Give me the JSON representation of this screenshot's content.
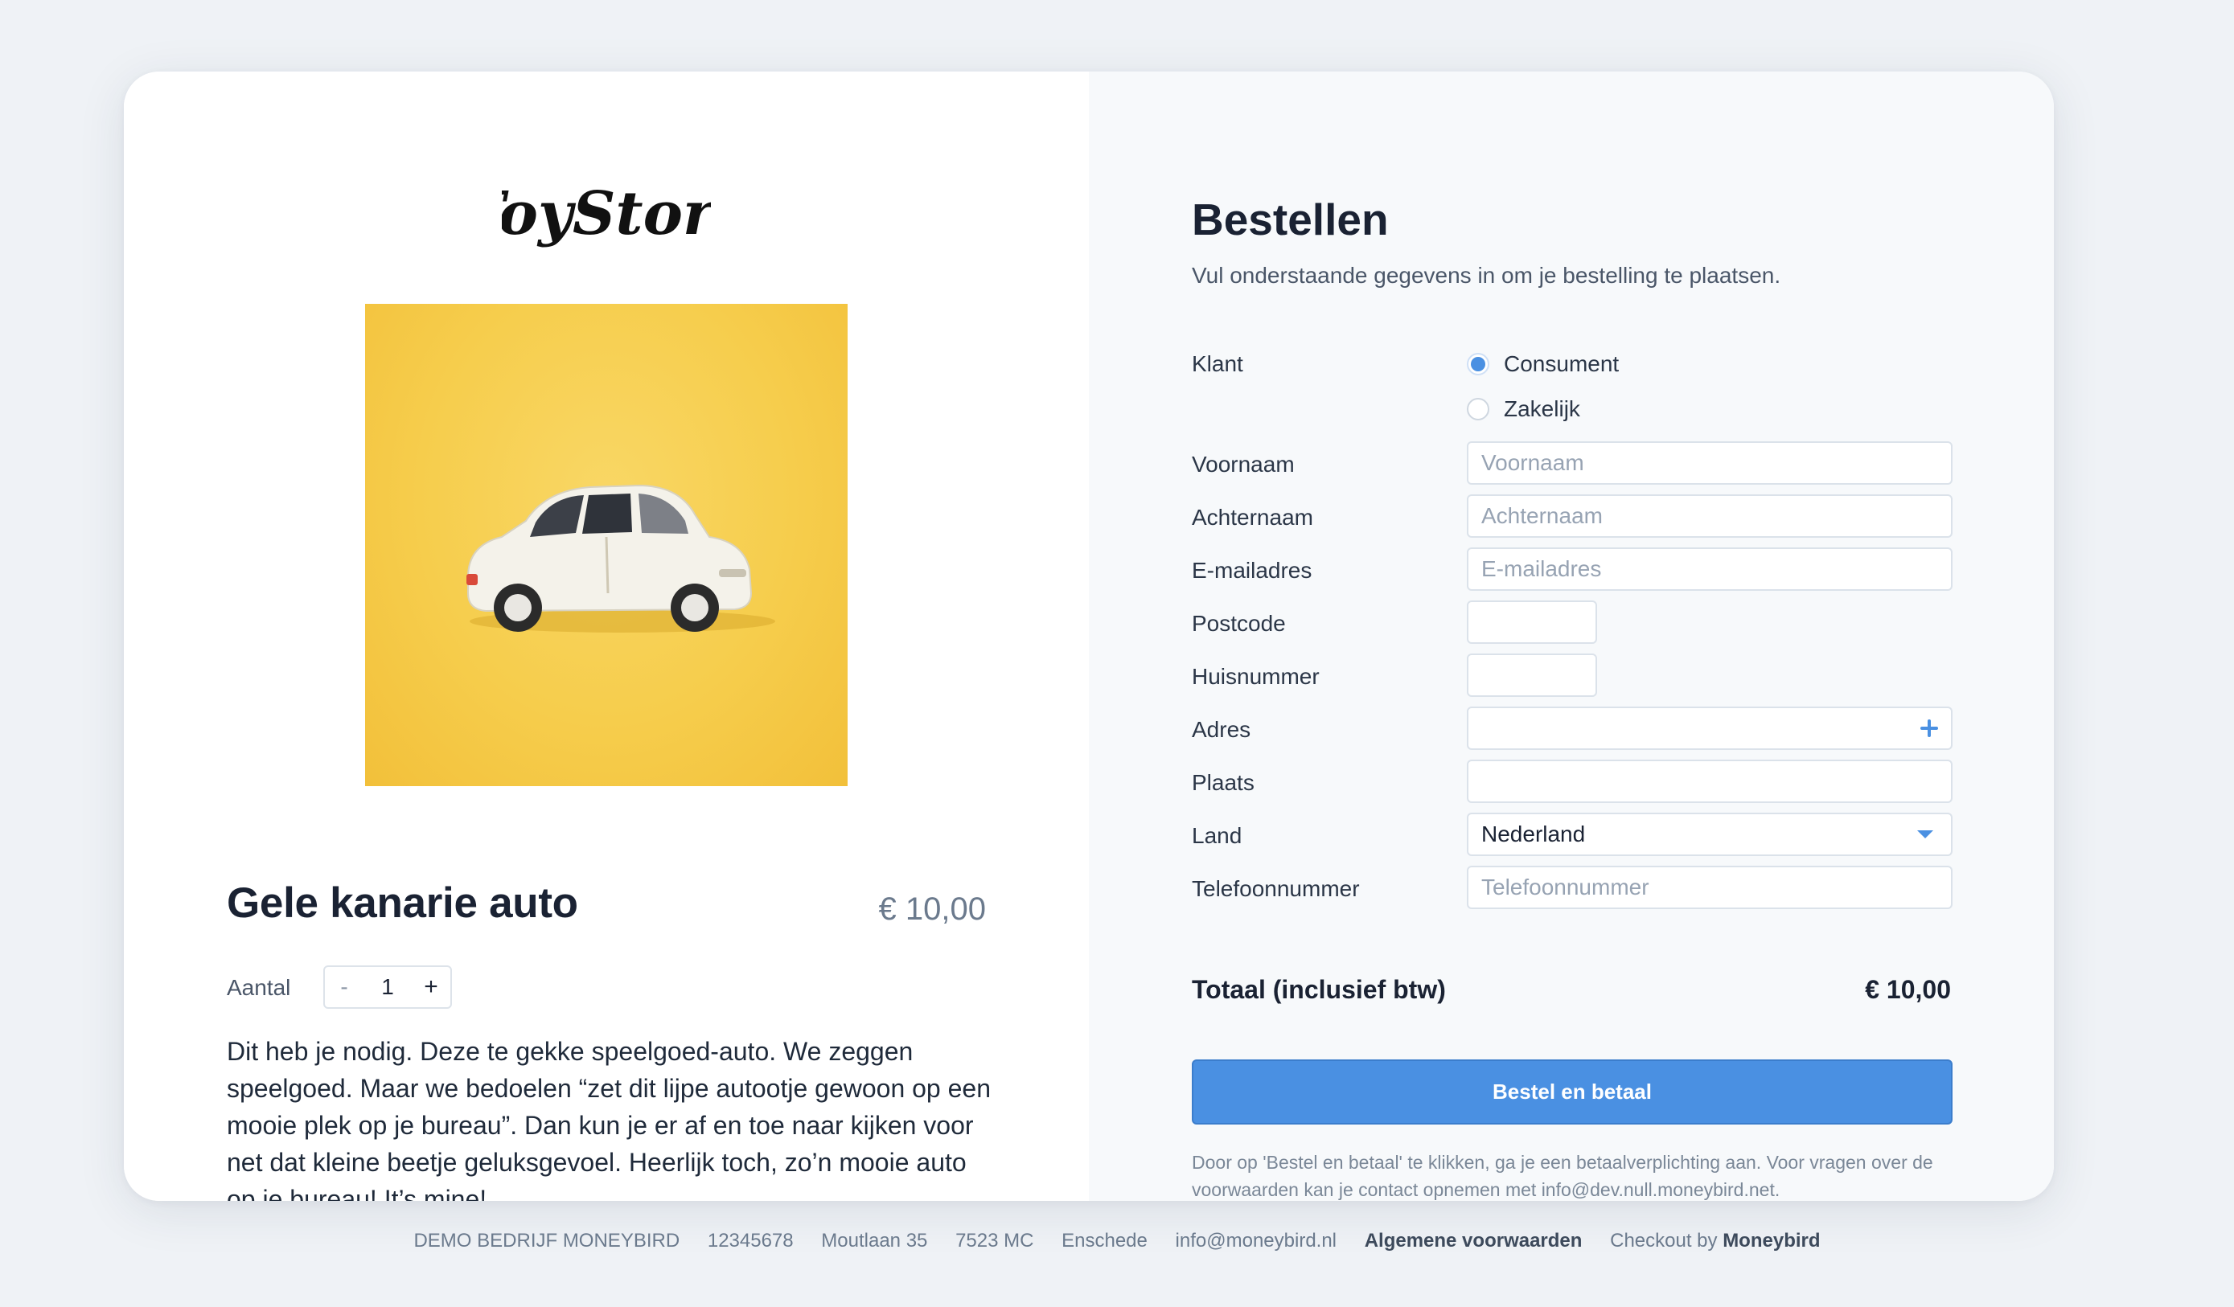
{
  "store": {
    "logo_text": "ToyStore"
  },
  "product": {
    "title": "Gele kanarie auto",
    "price": "€ 10,00",
    "quantity_label": "Aantal",
    "quantity_minus": "-",
    "quantity_value": "1",
    "quantity_plus": "+",
    "description": "Dit heb je nodig. Deze te gekke speelgoed-auto. We zeggen speelgoed. Maar we bedoelen “zet dit lijpe autootje gewoon op een mooie plek op je bureau”. Dan kun je er af en toe naar kijken voor net dat kleine beetje geluksgevoel. Heerlijk toch, zo’n mooie auto op je bureau! It’s mine!",
    "image_icon": "toy-car-photo",
    "image_background": "#f6cd4c"
  },
  "form": {
    "title": "Bestellen",
    "subtitle": "Vul onderstaande gegevens in om je bestelling te plaatsen.",
    "customer_label": "Klant",
    "customer_options": [
      {
        "label": "Consument",
        "checked": true
      },
      {
        "label": "Zakelijk",
        "checked": false
      }
    ],
    "fields": {
      "first_name": {
        "label": "Voornaam",
        "placeholder": "Voornaam",
        "value": ""
      },
      "last_name": {
        "label": "Achternaam",
        "placeholder": "Achternaam",
        "value": ""
      },
      "email": {
        "label": "E-mailadres",
        "placeholder": "E-mailadres",
        "value": ""
      },
      "postcode": {
        "label": "Postcode",
        "placeholder": "",
        "value": ""
      },
      "house_number": {
        "label": "Huisnummer",
        "placeholder": "",
        "value": ""
      },
      "address": {
        "label": "Adres",
        "placeholder": "",
        "value": ""
      },
      "city": {
        "label": "Plaats",
        "placeholder": "",
        "value": ""
      },
      "country": {
        "label": "Land",
        "value": "Nederland"
      },
      "phone": {
        "label": "Telefoonnummer",
        "placeholder": "Telefoonnummer",
        "value": ""
      }
    },
    "total_label": "Totaal (inclusief btw)",
    "total_value": "€ 10,00",
    "submit_label": "Bestel en betaal",
    "disclaimer": "Door op 'Bestel en betaal' te klikken, ga je een betaalverplichting aan. Voor vragen over de voorwaarden kan je contact opnemen met info@dev.null.moneybird.net.",
    "accent_color": "#4a90e2"
  },
  "footer": {
    "company": "DEMO BEDRIJF MONEYBIRD",
    "number": "12345678",
    "street": "Moutlaan 35",
    "postcode": "7523 MC",
    "city": "Enschede",
    "email": "info@moneybird.nl",
    "terms_link": "Algemene voorwaarden",
    "checkout_prefix": "Checkout by",
    "checkout_brand": "Moneybird"
  }
}
